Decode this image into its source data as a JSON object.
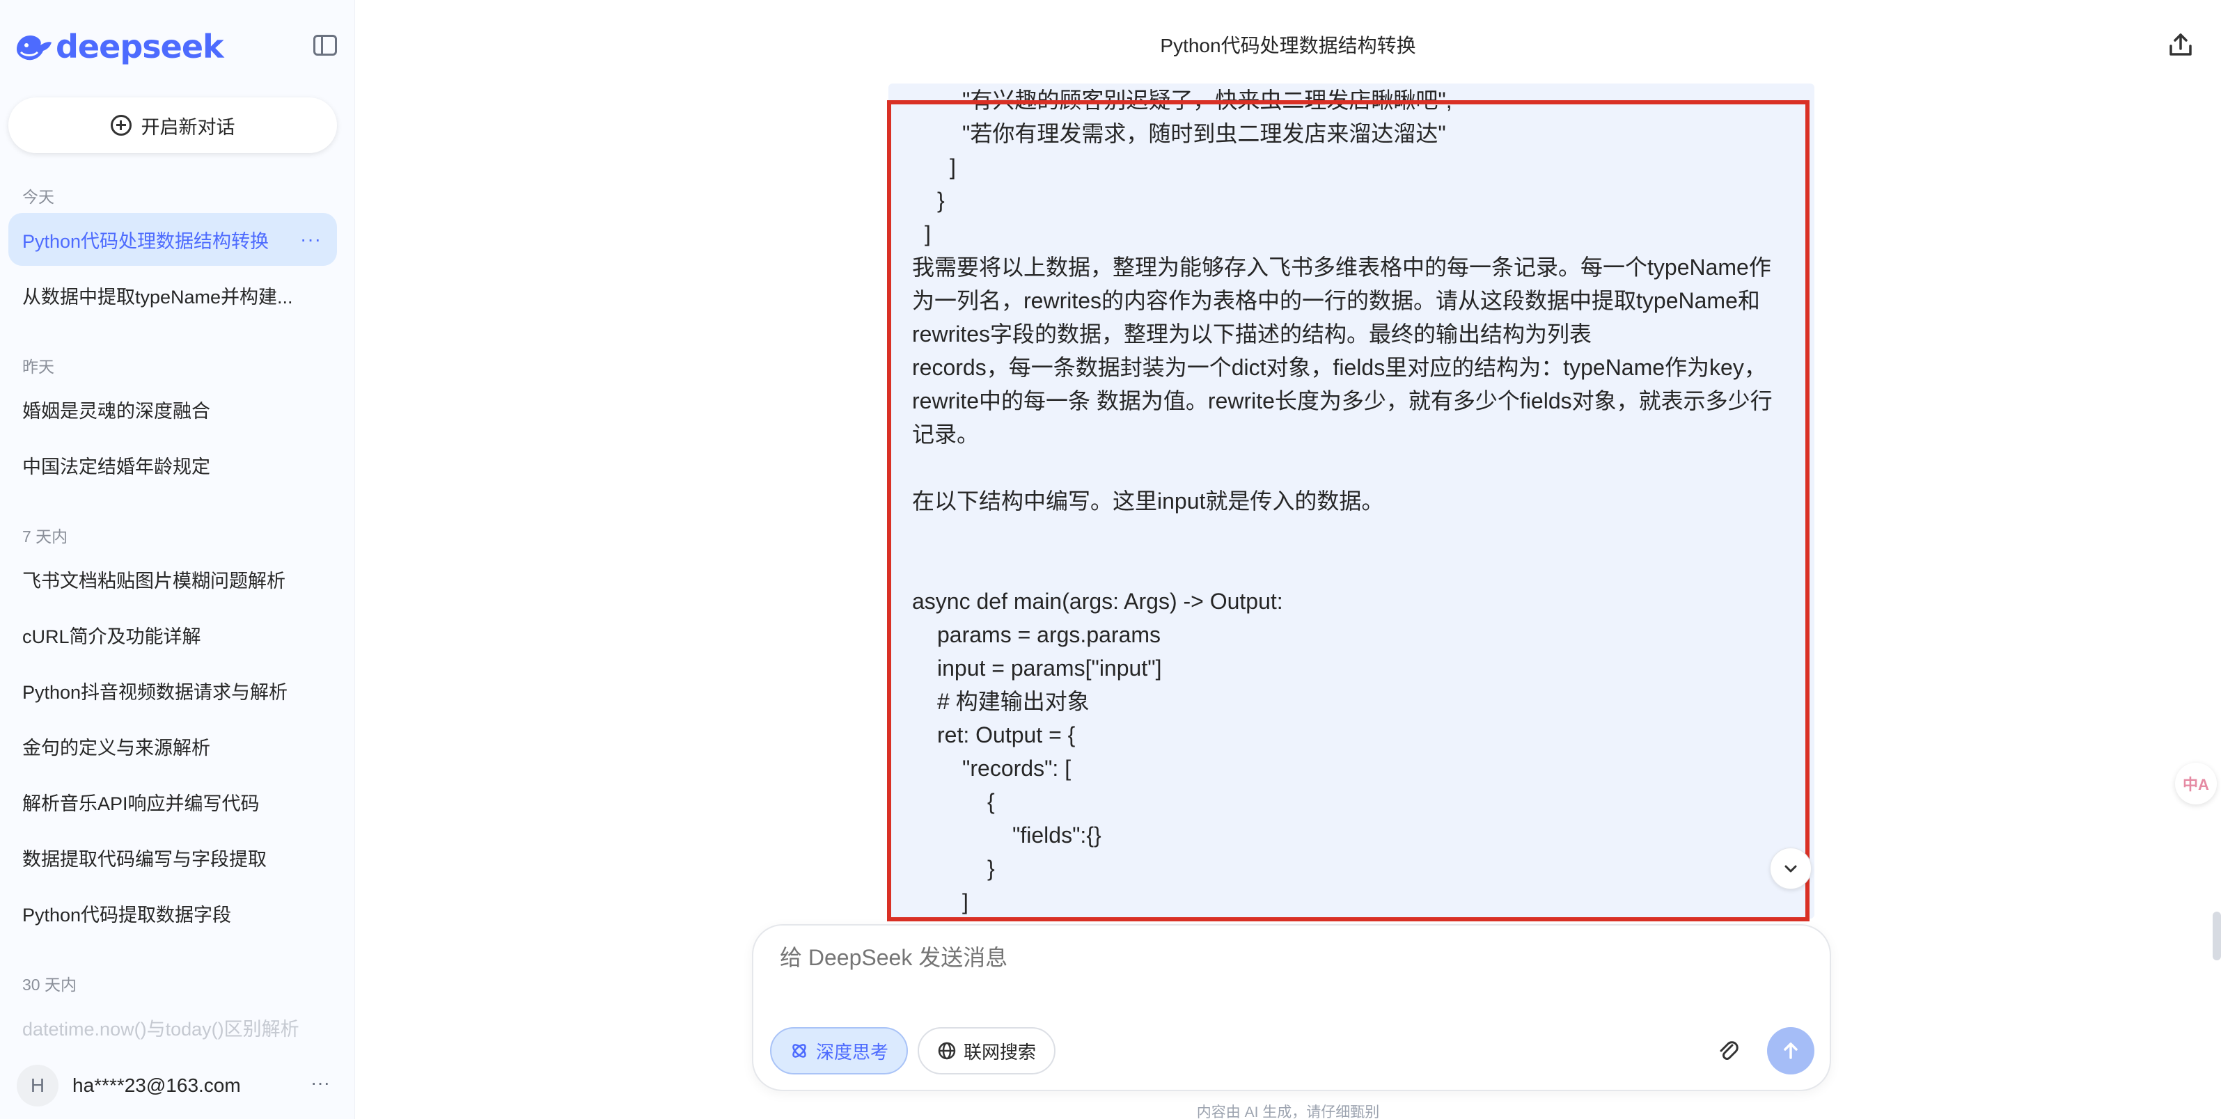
{
  "app": {
    "logo_text": "deepseek"
  },
  "sidebar": {
    "new_chat_label": "开启新对话",
    "groups": [
      {
        "label": "今天"
      },
      {
        "label": "昨天"
      },
      {
        "label": "7 天内"
      },
      {
        "label": "30 天内"
      }
    ],
    "items": [
      {
        "label": "Python代码处理数据结构转换",
        "active": true
      },
      {
        "label": "从数据中提取typeName并构建..."
      },
      {
        "label": "婚姻是灵魂的深度融合"
      },
      {
        "label": "中国法定结婚年龄规定"
      },
      {
        "label": "飞书文档粘贴图片模糊问题解析"
      },
      {
        "label": "cURL简介及功能详解"
      },
      {
        "label": "Python抖音视频数据请求与解析"
      },
      {
        "label": "金句的定义与来源解析"
      },
      {
        "label": "解析音乐API响应并编写代码"
      },
      {
        "label": "数据提取代码编写与字段提取"
      },
      {
        "label": "Python代码提取数据字段"
      },
      {
        "label": "datetime.now()与today()区别解析"
      }
    ],
    "active_more": "···",
    "user": {
      "avatar_letter": "H",
      "email": "ha****23@163.com",
      "more": "···"
    }
  },
  "main": {
    "title": "Python代码处理数据结构转换",
    "message_lines": [
      "\"有兴趣的顾客别迟疑了，快来虫二理发店瞅瞅吧\",",
      "\"若你有理发需求，随时到虫二理发店来溜达溜达\"",
      "]",
      "}",
      "]",
      "我需要将以上数据，整理为能够存入飞书多维表格中的每一条记录。每一个typeName作",
      "为一列名，rewrites的内容作为表格中的一行的数据。请从这段数据中提取typeName和",
      "rewrites字段的数据，整理为以下描述的结构。最终的输出结构为列表",
      "records，每一条数据封装为一个dict对象，fields里对应的结构为：typeName作为key，",
      "rewrite中的每一条 数据为值。rewrite长度为多少，就有多少个fields对象，就表示多少行",
      "记录。",
      "",
      "在以下结构中编写。这里input就是传入的数据。",
      "",
      "",
      "async def main(args: Args) -> Output:",
      "params = args.params",
      "input = params[\"input\"]",
      "# 构建输出对象",
      "ret: Output = {",
      "\"records\": [",
      "{",
      "\"fields\":{}",
      "}",
      "]"
    ]
  },
  "composer": {
    "placeholder": "给 DeepSeek 发送消息",
    "deep_think_label": "深度思考",
    "web_search_label": "联网搜索"
  },
  "footer": {
    "disclaimer": "内容由 AI 生成，请仔细甄别"
  },
  "floating": {
    "translate_label": "中A"
  },
  "colors": {
    "accent": "#4d6bfe",
    "highlight_border": "#d93025",
    "message_bg": "#eef3fd",
    "sidebar_bg": "#f9fbff"
  }
}
